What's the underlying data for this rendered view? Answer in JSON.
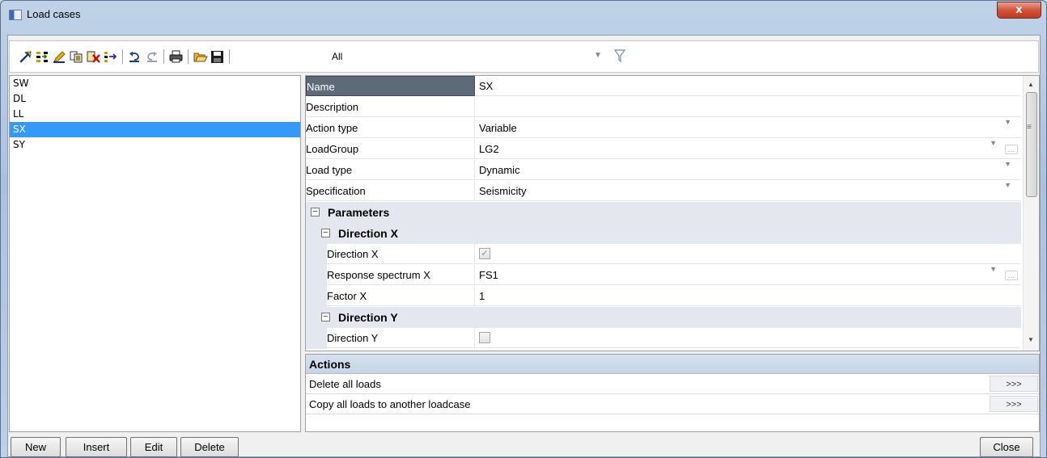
{
  "window": {
    "title": "Load cases",
    "close_glyph": "x"
  },
  "toolbar": {
    "icons": [
      "new-icon",
      "insert-icon",
      "edit-icon",
      "copy-icon",
      "delete-icon",
      "move-icon",
      "undo-icon",
      "redo-icon",
      "print-icon",
      "open-icon",
      "save-icon"
    ],
    "filter_value": "All"
  },
  "load_cases": {
    "items": [
      "SW",
      "DL",
      "LL",
      "SX",
      "SY"
    ],
    "selected": "SX"
  },
  "properties": {
    "name_label": "Name",
    "name_value": "SX",
    "description_label": "Description",
    "description_value": "",
    "action_type_label": "Action type",
    "action_type_value": "Variable",
    "loadgroup_label": "LoadGroup",
    "loadgroup_value": "LG2",
    "load_type_label": "Load type",
    "load_type_value": "Dynamic",
    "specification_label": "Specification",
    "specification_value": "Seismicity",
    "parameters_group": "Parameters",
    "direction_x_group": "Direction X",
    "direction_x_label": "Direction X",
    "direction_x_checked": true,
    "response_spectrum_x_label": "Response spectrum X",
    "response_spectrum_x_value": "FS1",
    "factor_x_label": "Factor X",
    "factor_x_value": "1",
    "direction_y_group": "Direction Y",
    "direction_y_label": "Direction Y",
    "direction_y_checked": false
  },
  "actions": {
    "header": "Actions",
    "items": [
      {
        "label": "Delete all loads",
        "button": ">>>"
      },
      {
        "label": "Copy all loads to another loadcase",
        "button": ">>>"
      }
    ]
  },
  "buttons": {
    "new": "New",
    "insert": "Insert",
    "edit": "Edit",
    "delete": "Delete",
    "close": "Close"
  },
  "colors": {
    "selection": "#3399ff",
    "selected_property": "#5d6a77",
    "group_band": "#e4e8ee"
  }
}
